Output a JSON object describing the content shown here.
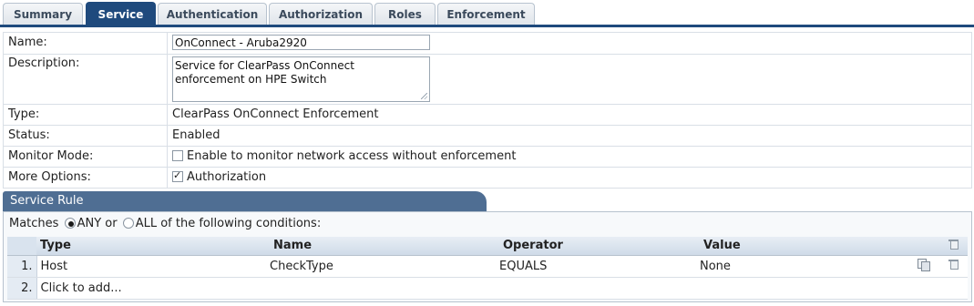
{
  "tabs": [
    {
      "label": "Summary"
    },
    {
      "label": "Service"
    },
    {
      "label": "Authentication"
    },
    {
      "label": "Authorization"
    },
    {
      "label": "Roles"
    },
    {
      "label": "Enforcement"
    }
  ],
  "active_tab": "Service",
  "fields": {
    "name_label": "Name:",
    "name_value": "OnConnect - Aruba2920",
    "description_label": "Description:",
    "description_value": "Service for ClearPass OnConnect enforcement on HPE Switch",
    "type_label": "Type:",
    "type_value": "ClearPass OnConnect Enforcement",
    "status_label": "Status:",
    "status_value": "Enabled",
    "monitor_label": "Monitor Mode:",
    "monitor_text": "Enable to monitor network access without enforcement",
    "monitor_checked": false,
    "options_label": "More Options:",
    "options_text": "Authorization",
    "options_checked": true
  },
  "service_rule": {
    "title": "Service Rule",
    "matches_prefix": "Matches",
    "any_label": "ANY or",
    "all_label": "ALL of the following conditions:",
    "selected": "ANY",
    "columns": [
      "Type",
      "Name",
      "Operator",
      "Value"
    ],
    "rows": [
      {
        "num": "1.",
        "type": "Host",
        "name": "CheckType",
        "operator": "EQUALS",
        "value": "None"
      }
    ],
    "add_num": "2.",
    "add_label": "Click to add..."
  },
  "colors": {
    "tab_active": "#1f4a7d",
    "rule_header": "#4f6e93"
  },
  "icons": [
    "copy-icon",
    "trash-icon"
  ]
}
